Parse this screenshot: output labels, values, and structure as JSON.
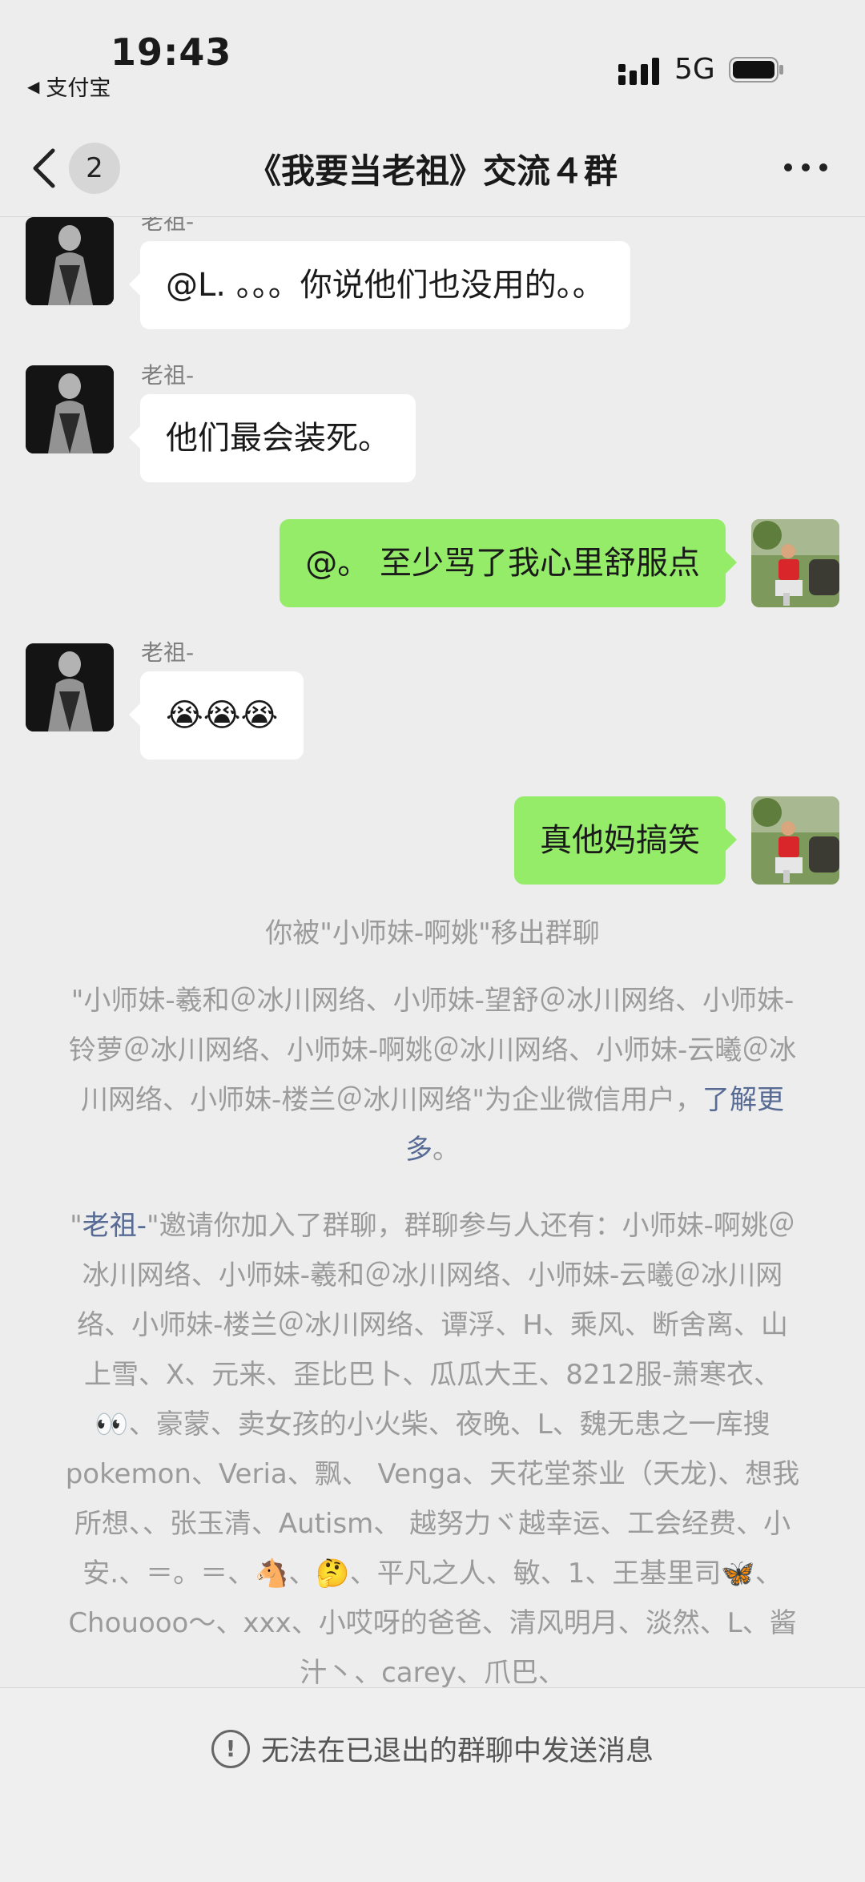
{
  "status_bar": {
    "time": "19:43",
    "back_app": "支付宝",
    "network": "5G"
  },
  "nav": {
    "unread_count": "2",
    "title": "《我要当老祖》交流４群"
  },
  "messages": [
    {
      "side": "left",
      "sender": "老祖-",
      "text": "@L. 。。。你说他们也没用的。。"
    },
    {
      "side": "left",
      "sender": "老祖-",
      "text": "他们最会装死。"
    },
    {
      "side": "right",
      "text": "@。 至少骂了我心里舒服点"
    },
    {
      "side": "left",
      "sender": "老祖-",
      "text": "😭😭😭"
    },
    {
      "side": "right",
      "text": "真他妈搞笑"
    }
  ],
  "system": {
    "removed": "你被\"小师妹-啊姚\"移出群聊",
    "enterprise": "\"小师妹-羲和＠冰川网络、小师妹-望舒＠冰川网络、小师妹-铃萝＠冰川网络、小师妹-啊姚＠冰川网络、小师妹-云曦＠冰川网络、小师妹-楼兰＠冰川网络\"为企业微信用户，",
    "learn_more": "了解更多",
    "learn_more_end": "。",
    "invite_quote": "\"",
    "invite_name": "老祖-",
    "invite_text": "\"邀请你加入了群聊，群聊参与人还有：小师妹-啊姚＠冰川网络、小师妹-羲和＠冰川网络、小师妹-云曦＠冰川网络、小师妹-楼兰＠冰川网络、谭浮、H、乘风、断舍离、山上雪、X、元来、歪比巴卜、瓜瓜大王、8212服-萧寒衣、👀、豪蒙、卖女孩的小火柴、夜晚、L、魏无患之一库搜pokemon、Veria、飘、 Venga、天花堂茶业（天龙)、想我所想、、张玉清、Autism、 越努力ヾ越幸运、工会经费、小安.、＝。＝、🐴、🤔、平凡之人、敏、1、王基里司🦋、Chouooo～、xxx、小哎呀的爸爸、清风明月、淡然、L、酱汁丶、carey、爪巴、"
  },
  "bottom": {
    "notice": "无法在已退出的群聊中发送消息"
  },
  "colors": {
    "background": "#ededed",
    "bubble_green": "#95ec69",
    "bubble_white": "#ffffff",
    "link": "#576b95"
  }
}
